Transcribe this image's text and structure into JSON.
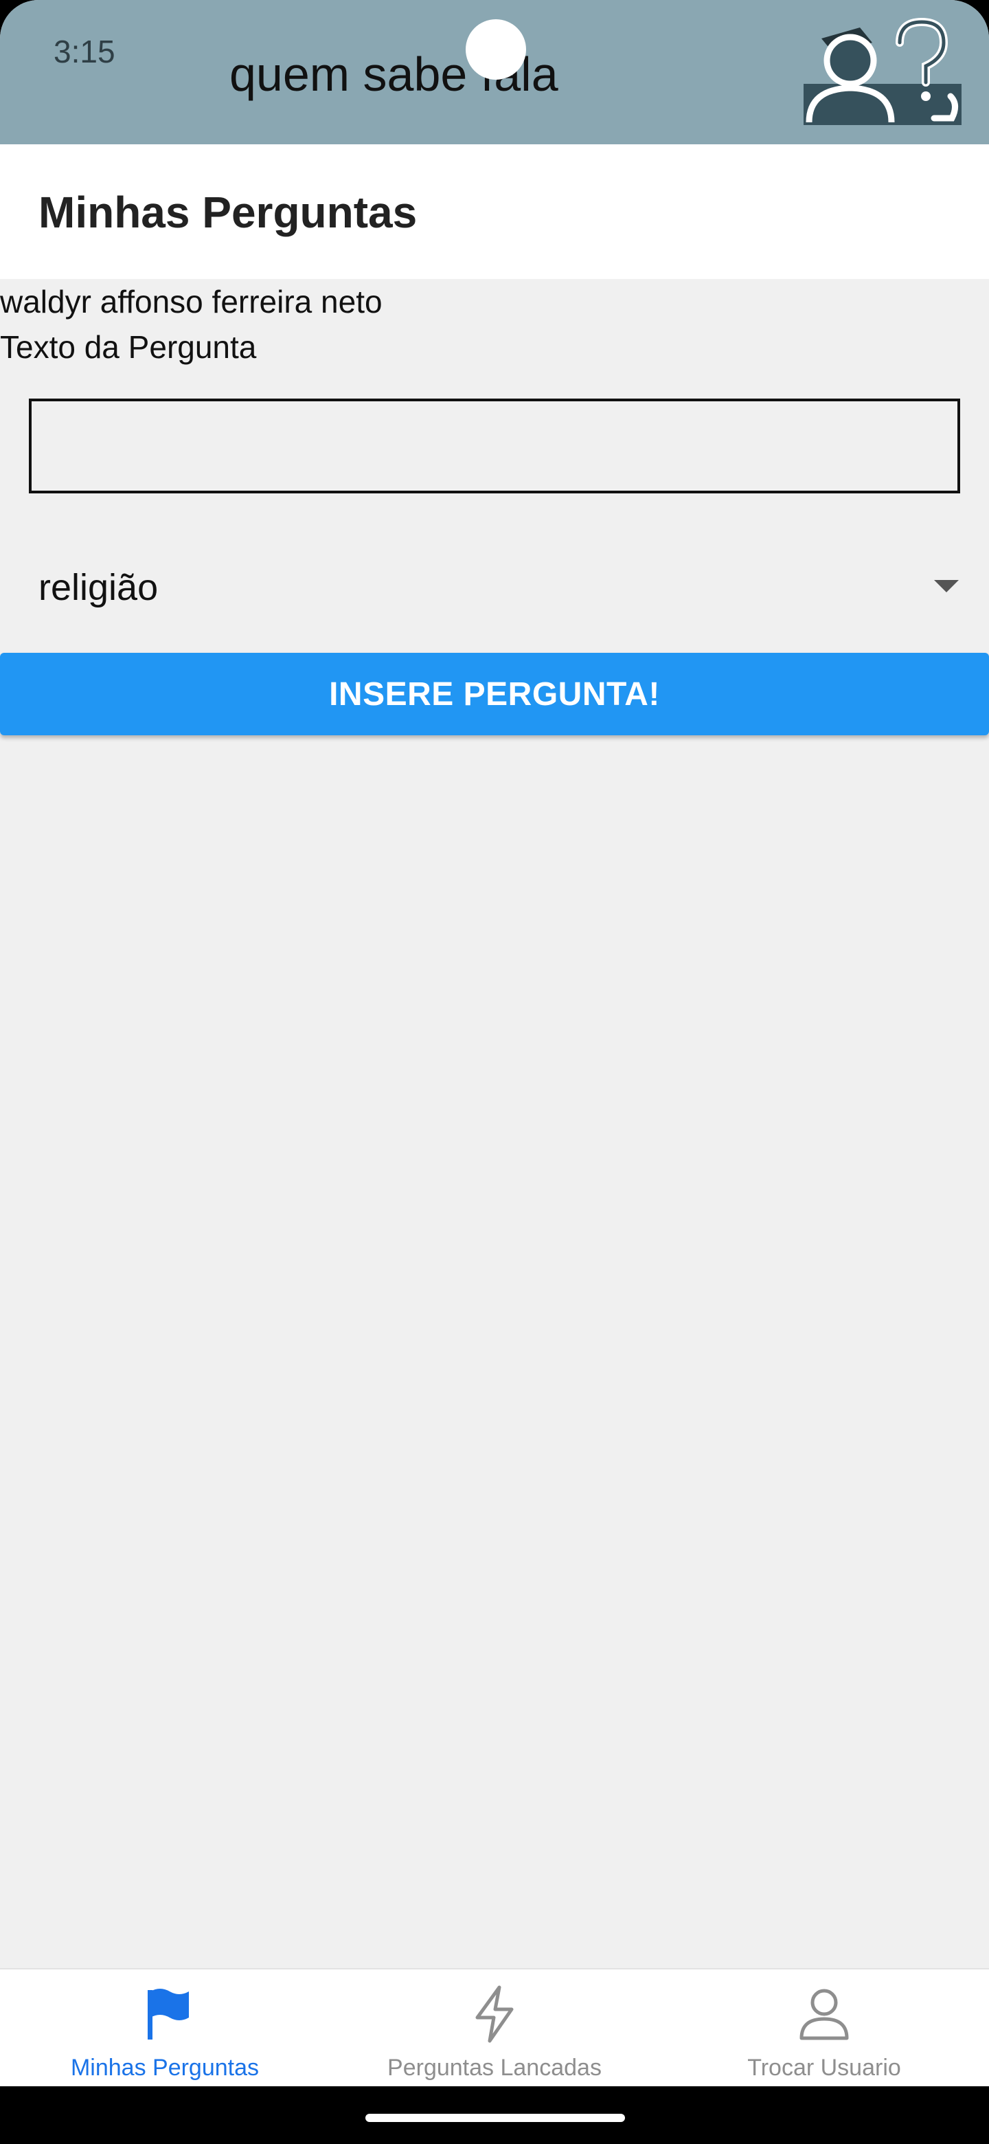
{
  "status_bar": {
    "time": "3:15"
  },
  "banner": {
    "app_name": "quem sabe fala"
  },
  "header": {
    "title": "Minhas Perguntas"
  },
  "form": {
    "user_name": "waldyr affonso ferreira neto",
    "question_label": "Texto da Pergunta",
    "question_value": "",
    "category_selected": "religião",
    "submit_label": "INSERE PERGUNTA!"
  },
  "bottom_nav": {
    "items": [
      {
        "label": "Minhas Perguntas",
        "icon": "flag-icon",
        "active": true
      },
      {
        "label": "Perguntas Lancadas",
        "icon": "lightning-icon",
        "active": false
      },
      {
        "label": "Trocar Usuario",
        "icon": "user-icon",
        "active": false
      }
    ]
  },
  "colors": {
    "banner": "#8aa7b2",
    "primary_button": "#2196f3",
    "active_tab": "#1a73e8",
    "inactive_tab": "#8e8e8e",
    "background": "#f0f0f0"
  }
}
